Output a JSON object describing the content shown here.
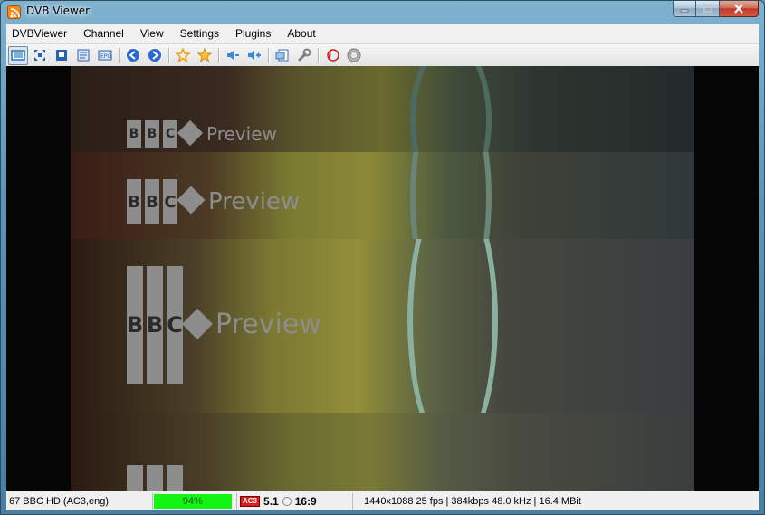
{
  "window": {
    "title": "DVB Viewer"
  },
  "menu": {
    "items": [
      "DVBViewer",
      "Channel",
      "View",
      "Settings",
      "Plugins",
      "About"
    ]
  },
  "toolbar": {
    "buttons": [
      {
        "name": "tv-mode-icon",
        "color": "#2f6fb3"
      },
      {
        "name": "fullscreen-icon",
        "color": "#2a60b0"
      },
      {
        "name": "osd-icon",
        "color": "#2a60b0"
      },
      {
        "name": "teletext-icon",
        "color": "#2a60b0"
      },
      {
        "name": "epg-icon",
        "color": "#2a60b0"
      },
      {
        "name": "previous-channel-icon",
        "color": "#2a6ad0"
      },
      {
        "name": "next-channel-icon",
        "color": "#2a6ad0"
      },
      {
        "name": "favorite-icon",
        "color": "#f2a21c"
      },
      {
        "name": "add-favorite-icon",
        "color": "#f2a21c"
      },
      {
        "name": "volume-down-icon",
        "color": "#3a8ad6"
      },
      {
        "name": "volume-up-icon",
        "color": "#3a8ad6"
      },
      {
        "name": "snapshot-icon",
        "color": "#3a6fb0"
      },
      {
        "name": "settings-wrench-icon",
        "color": "#7d7d7d"
      },
      {
        "name": "info-icon",
        "color": "#cc2020"
      },
      {
        "name": "record-icon",
        "color": "#8a8a8a"
      }
    ]
  },
  "video": {
    "logo_letters": [
      "B",
      "B",
      "C"
    ],
    "logo_word": "Preview"
  },
  "status": {
    "channel": "67 BBC HD (AC3,eng)",
    "signal_level": 0.94,
    "signal_text": "94%",
    "audio_badge": "AC3",
    "audio_channels": "5.1",
    "aspect": "16:9",
    "stream_info": "1440x1088 25 fps | 384kbps 48.0 kHz | 16.4 MBit",
    "signal_color": "#13f513"
  }
}
